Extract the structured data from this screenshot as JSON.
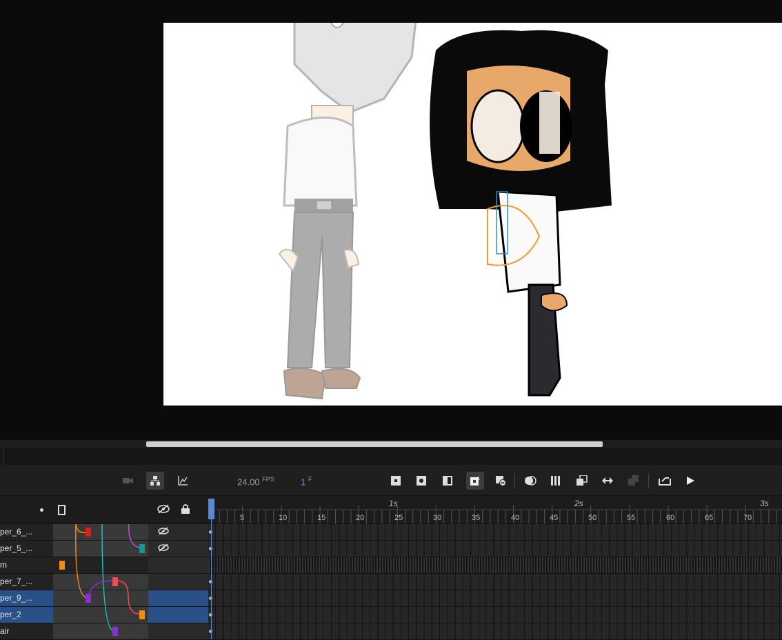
{
  "timeline": {
    "fps_value": "24.00",
    "fps_unit": "FPS",
    "frame_value": "1",
    "frame_unit": "F",
    "ruler": {
      "seconds": [
        "1s",
        "2s",
        "3s"
      ],
      "ticks": [
        "5",
        "10",
        "15",
        "20",
        "25",
        "30",
        "35",
        "40",
        "45",
        "50",
        "55",
        "60",
        "65",
        "70"
      ]
    },
    "layers": [
      {
        "name": "per_6_...",
        "hidden": true,
        "selected": false
      },
      {
        "name": "per_5_...",
        "hidden": true,
        "selected": false
      },
      {
        "name": "m",
        "hidden": false,
        "selected": false
      },
      {
        "name": "per_7_...",
        "hidden": false,
        "selected": false
      },
      {
        "name": "per_9_...",
        "hidden": false,
        "selected": true
      },
      {
        "name": "per_2",
        "hidden": false,
        "selected": true
      },
      {
        "name": "air",
        "hidden": false,
        "selected": false
      }
    ],
    "colors": {
      "selected_row": "#2a5187",
      "playhead": "#5b89c9"
    }
  }
}
